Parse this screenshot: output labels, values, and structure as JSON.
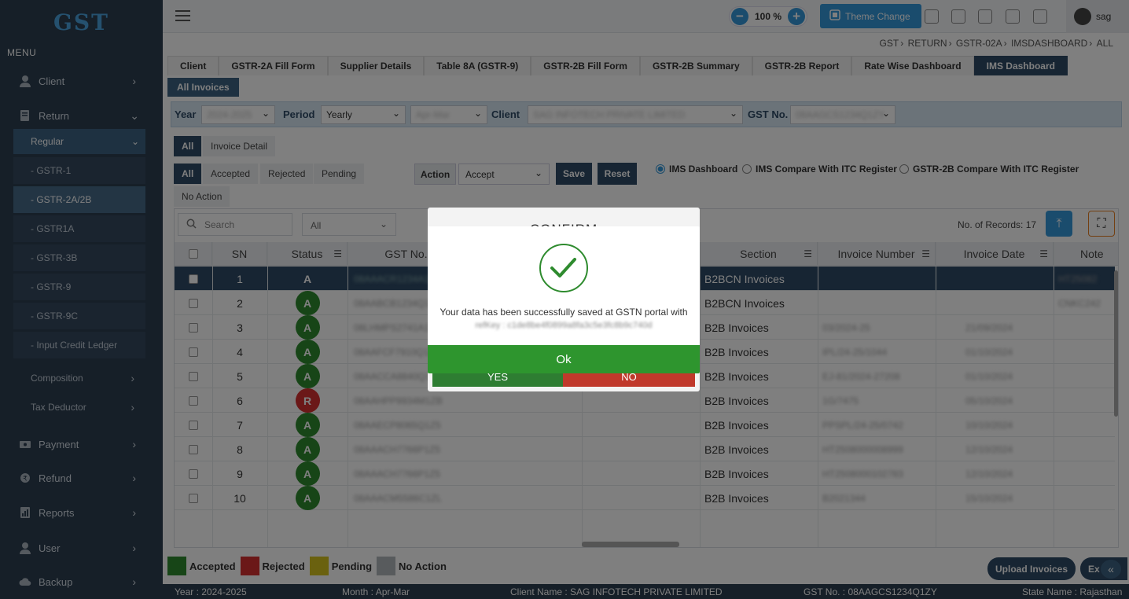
{
  "app": {
    "logo": "GST",
    "menu_label": "MENU"
  },
  "sidebar": {
    "client": "Client",
    "return": "Return",
    "regular": "Regular",
    "regular_items": [
      "- GSTR-1",
      "- GSTR-2A/2B",
      "- GSTR1A",
      "- GSTR-3B",
      "- GSTR-9",
      "- GSTR-9C",
      "- Input Credit Ledger"
    ],
    "composition": "Composition",
    "tax_deductor": "Tax Deductor",
    "payment": "Payment",
    "refund": "Refund",
    "reports": "Reports",
    "user": "User",
    "backup": "Backup"
  },
  "topbar": {
    "zoom": "100 %",
    "theme_change": "Theme Change",
    "username": "sag"
  },
  "breadcrumb": [
    "GST",
    "RETURN",
    "GSTR-02A",
    "IMSDASHBOARD",
    "ALL"
  ],
  "tabs": [
    "Client",
    "GSTR-2A Fill Form",
    "Supplier Details",
    "Table 8A (GSTR-9)",
    "GSTR-2B Fill Form",
    "GSTR-2B Summary",
    "GSTR-2B Report",
    "Rate Wise Dashboard",
    "IMS Dashboard"
  ],
  "subtab": "All Invoices",
  "filter": {
    "year_label": "Year",
    "year_value": "2024-2025",
    "period_label": "Period",
    "period_value": "Yearly",
    "period_range": "Apr-Mar",
    "client_label": "Client",
    "client_value": "SAG INFOTECH PRIVATE LIMITED",
    "gst_label": "GST No.",
    "gst_value": "08AAGCS1234Q1ZY"
  },
  "view_chips": [
    "All",
    "Invoice Detail"
  ],
  "status_chips": [
    "All",
    "Accepted",
    "Rejected",
    "Pending",
    "No Action"
  ],
  "action": {
    "label": "Action",
    "value": "Accept",
    "save": "Save",
    "reset": "Reset"
  },
  "radios": [
    "IMS Dashboard",
    "IMS Compare With ITC Register",
    "GSTR-2B Compare With ITC Register"
  ],
  "grid": {
    "search_placeholder": "Search",
    "filter_value": "All",
    "records": "No. of Records: 17",
    "columns": [
      "SN",
      "Status",
      "GST No.",
      "Section",
      "Invoice Number",
      "Invoice Date",
      "Note"
    ],
    "rows": [
      {
        "sn": "1",
        "status": "A",
        "gst": "08AAACR1234A1Z5",
        "section": "B2BCN Invoices",
        "inv": "",
        "date": "",
        "note": "HT25082"
      },
      {
        "sn": "2",
        "status": "A",
        "gst": "08AABCB1234Q1ZY",
        "section": "B2BCN Invoices",
        "inv": "",
        "date": "",
        "note": "CNKC242"
      },
      {
        "sn": "3",
        "status": "A",
        "gst": "08LHMPS2741A1Z",
        "section": "B2B Invoices",
        "inv": "03/2024-25",
        "date": "21/09/2024",
        "note": ""
      },
      {
        "sn": "4",
        "status": "A",
        "gst": "08AAFCF7910Q1Z",
        "section": "B2B Invoices",
        "inv": "IPL/24-25/1044",
        "date": "01/10/2024",
        "note": ""
      },
      {
        "sn": "5",
        "status": "A",
        "gst": "08AACCA8840Q1Z",
        "section": "B2B Invoices",
        "inv": "EJ-81/2024-27208",
        "date": "01/10/2024",
        "note": ""
      },
      {
        "sn": "6",
        "status": "R",
        "gst": "08AAHPP9934M1ZB",
        "section": "B2B Invoices",
        "inv": "1G/7475",
        "date": "05/10/2024",
        "note": ""
      },
      {
        "sn": "7",
        "status": "A",
        "gst": "08AAECP8065Q1Z5",
        "section": "B2B Invoices",
        "inv": "PPSPL/24-25/0742",
        "date": "10/10/2024",
        "note": ""
      },
      {
        "sn": "8",
        "status": "A",
        "gst": "08AAACH7766P1Z5",
        "section": "B2B Invoices",
        "inv": "HT2508000008999",
        "date": "12/10/2024",
        "note": ""
      },
      {
        "sn": "9",
        "status": "A",
        "gst": "08AAACH7766P1Z5",
        "section": "B2B Invoices",
        "inv": "HT2508000102783",
        "date": "12/10/2024",
        "note": ""
      },
      {
        "sn": "10",
        "status": "A",
        "gst": "08AAACM5586C1ZL",
        "section": "B2B Invoices",
        "inv": "B2021344",
        "date": "15/10/2024",
        "note": ""
      }
    ]
  },
  "legend": [
    "Accepted",
    "Rejected",
    "Pending",
    "No Action"
  ],
  "bottom_buttons": {
    "upload": "Upload Invoices",
    "exit": "Ex"
  },
  "footer": {
    "year": "Year : 2024-2025",
    "month": "Month : Apr-Mar",
    "client": "Client Name : SAG INFOTECH PRIVATE LIMITED",
    "gst": "GST No. : 08AAGCS1234Q1ZY",
    "state": "State Name : Rajasthan"
  },
  "confirm_dialog": {
    "title": "CONFIRM",
    "yes": "YES",
    "no": "NO"
  },
  "success_dialog": {
    "message": "Your data has been successfully saved at GSTN portal with",
    "ref": "refKey : c1de8be4f0899a8fa3c5e3fc8b9c740d",
    "ok": "Ok"
  },
  "colors": {
    "sidebar": "#2c3e50",
    "accent": "#3498db",
    "dark": "#2e4a66",
    "accepted": "#2e8b2e",
    "rejected": "#d63031",
    "pending": "#d4c21f",
    "no_action": "#b0b6bb"
  }
}
